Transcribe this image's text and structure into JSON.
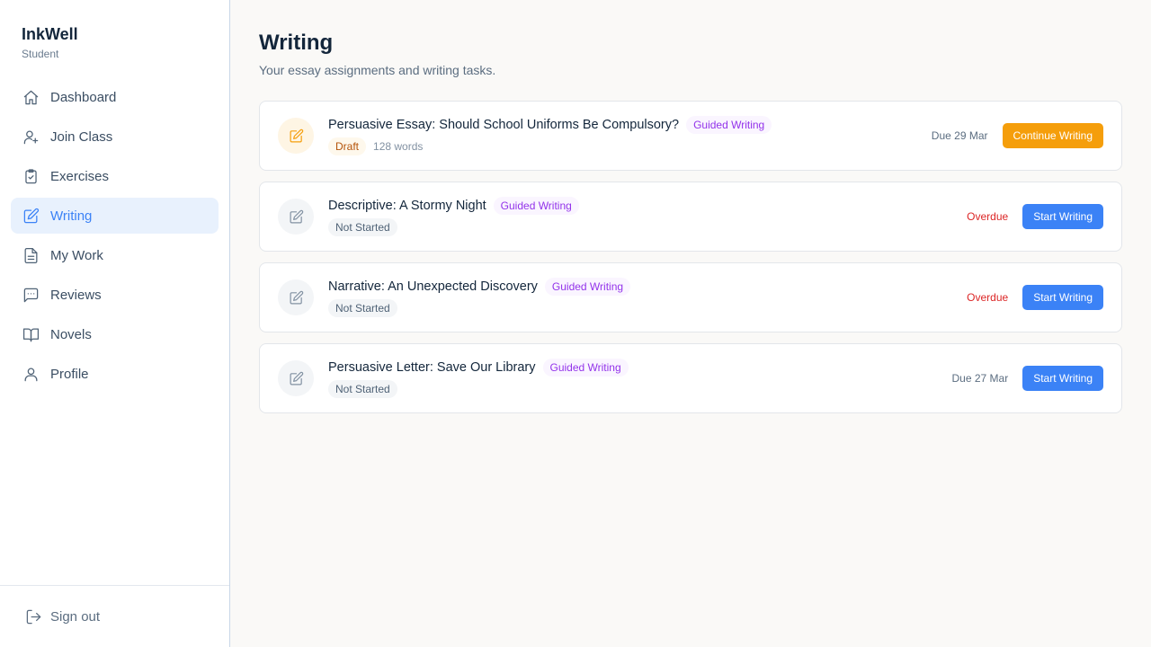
{
  "brand": {
    "name": "InkWell",
    "role": "Student"
  },
  "nav": [
    {
      "label": "Dashboard",
      "icon": "home-icon"
    },
    {
      "label": "Join Class",
      "icon": "user-plus-icon"
    },
    {
      "label": "Exercises",
      "icon": "clipboard-check-icon"
    },
    {
      "label": "Writing",
      "icon": "pencil-square-icon",
      "active": true
    },
    {
      "label": "My Work",
      "icon": "document-icon"
    },
    {
      "label": "Reviews",
      "icon": "message-icon"
    },
    {
      "label": "Novels",
      "icon": "book-icon"
    },
    {
      "label": "Profile",
      "icon": "user-icon"
    }
  ],
  "footer": {
    "signout_label": "Sign out"
  },
  "page": {
    "title": "Writing",
    "subtitle": "Your essay assignments and writing tasks."
  },
  "tasks": [
    {
      "title": "Persuasive Essay: Should School Uniforms Be Compulsory?",
      "tag": "Guided Writing",
      "status": "Draft",
      "words": "128 words",
      "due": "Due 29 Mar",
      "action": "Continue Writing"
    },
    {
      "title": "Descriptive: A Stormy Night",
      "tag": "Guided Writing",
      "status": "Not Started",
      "due": "Overdue",
      "action": "Start Writing"
    },
    {
      "title": "Narrative: An Unexpected Discovery",
      "tag": "Guided Writing",
      "status": "Not Started",
      "due": "Overdue",
      "action": "Start Writing"
    },
    {
      "title": "Persuasive Letter: Save Our Library",
      "tag": "Guided Writing",
      "status": "Not Started",
      "due": "Due 27 Mar",
      "action": "Start Writing"
    }
  ],
  "colors": {
    "accent": "#3b82f6",
    "draft": "#f59e0b",
    "overdue": "#dc2626",
    "tag": "#9333ea"
  }
}
